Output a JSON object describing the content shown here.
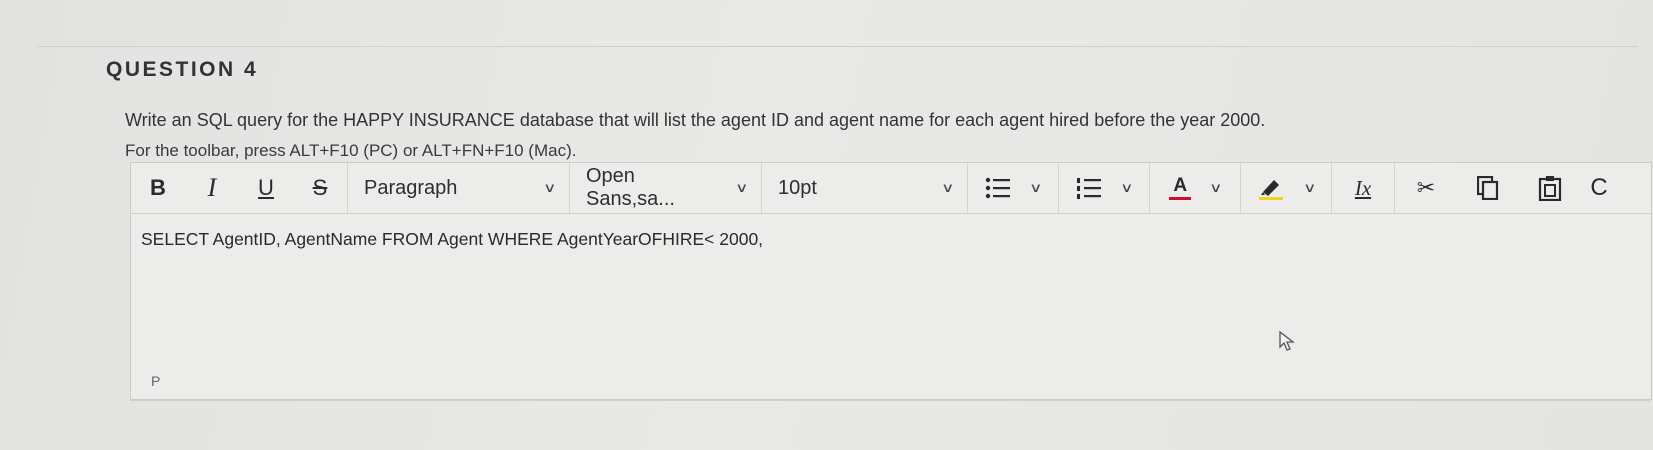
{
  "question": {
    "title": "QUESTION 4",
    "text": "Write an SQL query for the HAPPY INSURANCE database that will list the agent ID and agent name for each agent hired before the year 2000."
  },
  "editor": {
    "toolbar_hint": "For the toolbar, press ALT+F10 (PC) or ALT+FN+F10 (Mac).",
    "format_buttons": {
      "bold": "B",
      "italic": "I",
      "underline": "U",
      "strike": "S"
    },
    "block_format": "Paragraph",
    "font_family": "Open Sans,sa...",
    "font_size": "10pt",
    "text_color_letter": "A",
    "clear_format_letter": "Ix",
    "content": "SELECT AgentID, AgentName FROM Agent WHERE AgentYearOFHIRE< 2000,",
    "status_path": "P"
  },
  "icons": {
    "bullet_list": "bullet-list-icon",
    "numbered_list": "numbered-list-icon",
    "text_color": "text-color-icon",
    "highlight": "highlighter-icon",
    "clear_format": "clear-format-icon",
    "cut": "scissors-icon",
    "copy": "copy-icon",
    "paste": "paste-icon"
  },
  "colors": {
    "text_color_bar": "#c8102e",
    "highlight_bar": "#f2d21b"
  }
}
